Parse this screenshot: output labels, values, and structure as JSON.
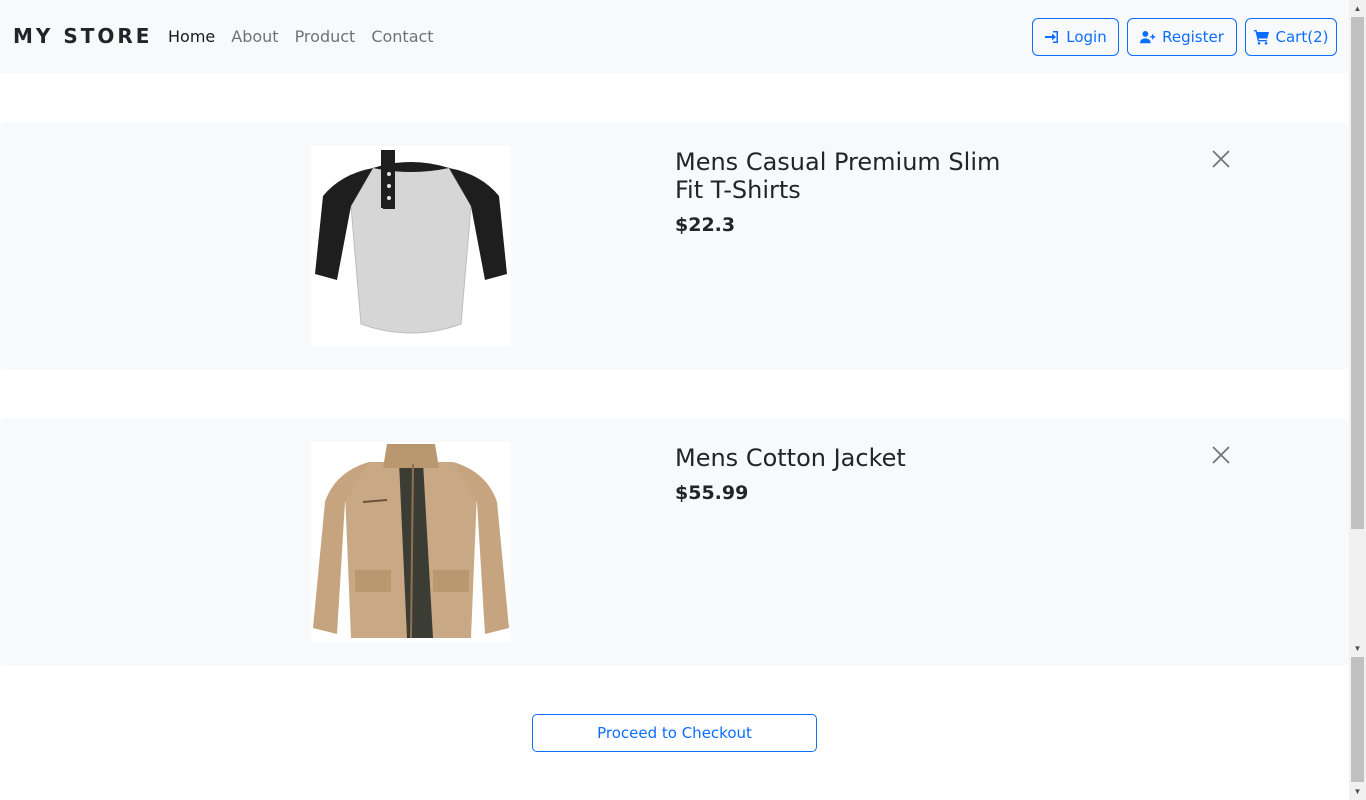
{
  "navbar": {
    "brand": "MY STORE",
    "links": [
      "Home",
      "About",
      "Product",
      "Contact"
    ],
    "login_label": "Login",
    "register_label": "Register",
    "cart_label": "Cart(2)"
  },
  "cart": {
    "items": [
      {
        "title": "Mens Casual Premium Slim Fit T-Shirts",
        "price": "$22.3",
        "image": "raglan-henley-tshirt-image"
      },
      {
        "title": "Mens Cotton Jacket",
        "price": "$55.99",
        "image": "khaki-cotton-jacket-image"
      }
    ],
    "checkout_label": "Proceed to Checkout"
  },
  "colors": {
    "accent": "#0d6efd",
    "navbar_bg": "#f8f9fa",
    "card_bg": "#f8f9fa"
  }
}
